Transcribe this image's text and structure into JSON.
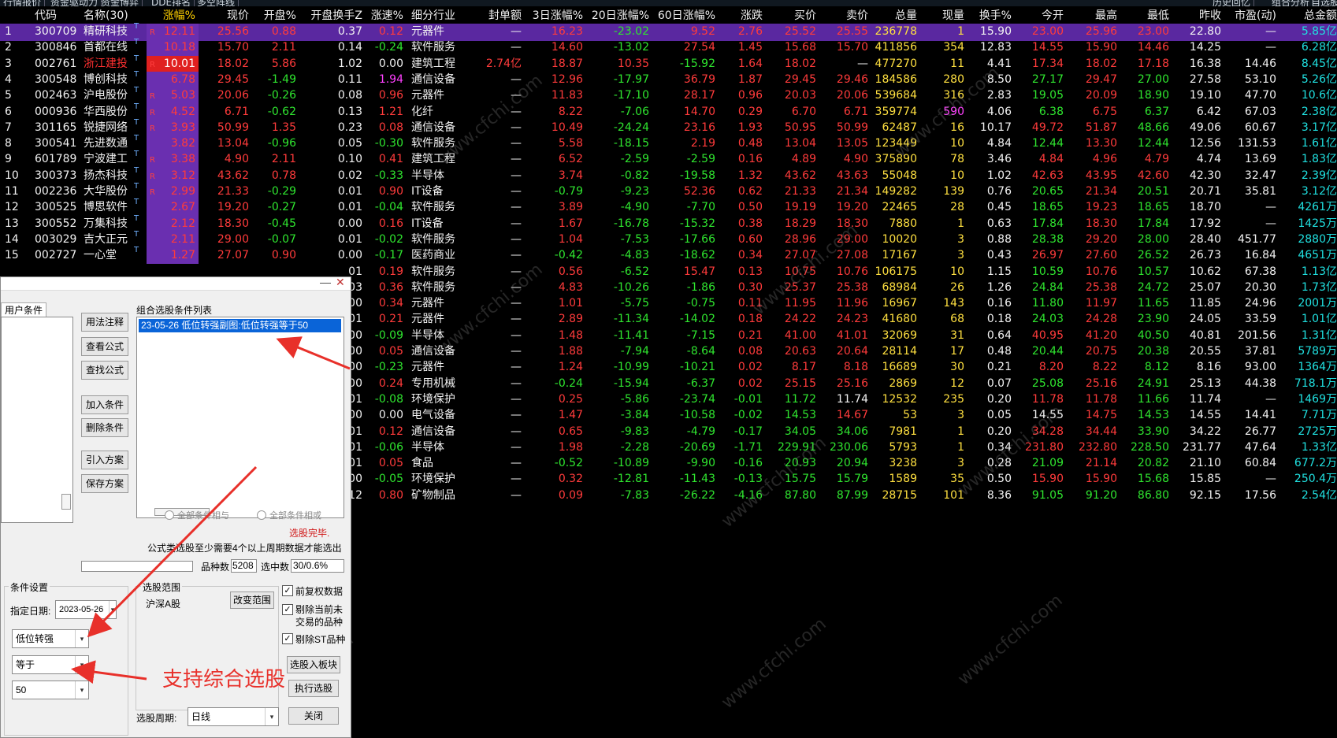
{
  "top_tabs": [
    "行情报价",
    "资金驱动力",
    "资金博弈",
    "DDE排名",
    "多空阵线",
    "历史回忆",
    "组合分析",
    "自选股"
  ],
  "header": {
    "idx": "",
    "code": "代码",
    "name": "名称(30)",
    "dot": "•",
    "zf": "涨幅%",
    "price": "现价",
    "kp": "开盘%",
    "kphs": "开盘换手Z",
    "zs": "涨速%",
    "hy": "细分行业",
    "fd": "封单额",
    "z3": "3日涨幅%",
    "z20": "20日涨幅%",
    "z60": "60日涨幅%",
    "zd": "涨跌",
    "buy": "买价",
    "sell": "卖价",
    "vol": "总量",
    "xl": "现量",
    "hs": "换手%",
    "jk": "今开",
    "zg": "最高",
    "zdi": "最低",
    "zs2": "昨收",
    "sy": "市盈(动)",
    "zje": "总金额"
  },
  "rows": [
    {
      "i": "1",
      "code": "300709",
      "name": "精研科技",
      "r": "R",
      "zf": "12.11",
      "p": "25.56",
      "kp": "0.88",
      "kphs": "0.37",
      "zs": "0.12",
      "hy": "元器件",
      "fd": "—",
      "z3": "16.23",
      "z20": "-23.02",
      "z60": "9.52",
      "zd": "2.76",
      "b": "25.52",
      "s": "25.55",
      "v": "236778",
      "x": "1",
      "h": "15.90",
      "jk": "23.00",
      "zg": "25.96",
      "zdi": "23.00",
      "zs2": "22.80",
      "sy": "—",
      "je": "5.85亿"
    },
    {
      "i": "2",
      "code": "300846",
      "name": "首都在线",
      "r": "",
      "zf": "10.18",
      "p": "15.70",
      "kp": "2.11",
      "kphs": "0.14",
      "zs": "-0.24",
      "hy": "软件服务",
      "fd": "—",
      "z3": "14.60",
      "z20": "-13.02",
      "z60": "27.54",
      "zd": "1.45",
      "b": "15.68",
      "s": "15.70",
      "v": "411856",
      "x": "354",
      "h": "12.83",
      "jk": "14.55",
      "zg": "15.90",
      "zdi": "14.46",
      "zs2": "14.25",
      "sy": "—",
      "je": "6.28亿"
    },
    {
      "i": "3",
      "code": "002761",
      "name": "浙江建投",
      "r": "R",
      "zf": "10.01",
      "p": "18.02",
      "kp": "5.86",
      "kphs": "1.02",
      "zs": "0.00",
      "hy": "建筑工程",
      "fd": "2.74亿",
      "z3": "18.87",
      "z20": "10.35",
      "z60": "-15.92",
      "zd": "1.64",
      "b": "18.02",
      "s": "—",
      "v": "477270",
      "x": "11",
      "h": "4.41",
      "jk": "17.34",
      "zg": "18.02",
      "zdi": "17.18",
      "zs2": "16.38",
      "sy": "14.46",
      "je": "8.45亿"
    },
    {
      "i": "4",
      "code": "300548",
      "name": "博创科技",
      "r": "",
      "zf": "6.78",
      "p": "29.45",
      "kp": "-1.49",
      "kphs": "0.11",
      "zs": "1.94",
      "hy": "通信设备",
      "fd": "—",
      "z3": "12.96",
      "z20": "-17.97",
      "z60": "36.79",
      "zd": "1.87",
      "b": "29.45",
      "s": "29.46",
      "v": "184586",
      "x": "280",
      "h": "8.50",
      "jk": "27.17",
      "zg": "29.47",
      "zdi": "27.00",
      "zs2": "27.58",
      "sy": "53.10",
      "je": "5.26亿"
    },
    {
      "i": "5",
      "code": "002463",
      "name": "沪电股份",
      "r": "R",
      "zf": "5.03",
      "p": "20.06",
      "kp": "-0.26",
      "kphs": "0.08",
      "zs": "0.96",
      "hy": "元器件",
      "fd": "—",
      "z3": "11.83",
      "z20": "-17.10",
      "z60": "28.17",
      "zd": "0.96",
      "b": "20.03",
      "s": "20.06",
      "v": "539684",
      "x": "316",
      "h": "2.83",
      "jk": "19.05",
      "zg": "20.09",
      "zdi": "18.90",
      "zs2": "19.10",
      "sy": "47.70",
      "je": "10.6亿"
    },
    {
      "i": "6",
      "code": "000936",
      "name": "华西股份",
      "r": "R",
      "zf": "4.52",
      "p": "6.71",
      "kp": "-0.62",
      "kphs": "0.13",
      "zs": "1.21",
      "hy": "化纤",
      "fd": "—",
      "z3": "8.22",
      "z20": "-7.06",
      "z60": "14.70",
      "zd": "0.29",
      "b": "6.70",
      "s": "6.71",
      "v": "359774",
      "x": "590",
      "h": "4.06",
      "jk": "6.38",
      "zg": "6.75",
      "zdi": "6.37",
      "zs2": "6.42",
      "sy": "67.03",
      "je": "2.38亿"
    },
    {
      "i": "7",
      "code": "301165",
      "name": "锐捷网络",
      "r": "R",
      "zf": "3.93",
      "p": "50.99",
      "kp": "1.35",
      "kphs": "0.23",
      "zs": "0.08",
      "hy": "通信设备",
      "fd": "—",
      "z3": "10.49",
      "z20": "-24.24",
      "z60": "23.16",
      "zd": "1.93",
      "b": "50.95",
      "s": "50.99",
      "v": "62487",
      "x": "16",
      "h": "10.17",
      "jk": "49.72",
      "zg": "51.87",
      "zdi": "48.66",
      "zs2": "49.06",
      "sy": "60.67",
      "je": "3.17亿"
    },
    {
      "i": "8",
      "code": "300541",
      "name": "先进数通",
      "r": "",
      "zf": "3.82",
      "p": "13.04",
      "kp": "-0.96",
      "kphs": "0.05",
      "zs": "-0.30",
      "hy": "软件服务",
      "fd": "—",
      "z3": "5.58",
      "z20": "-18.15",
      "z60": "2.19",
      "zd": "0.48",
      "b": "13.04",
      "s": "13.05",
      "v": "123449",
      "x": "10",
      "h": "4.84",
      "jk": "12.44",
      "zg": "13.30",
      "zdi": "12.44",
      "zs2": "12.56",
      "sy": "131.53",
      "je": "1.61亿"
    },
    {
      "i": "9",
      "code": "601789",
      "name": "宁波建工",
      "r": "R",
      "zf": "3.38",
      "p": "4.90",
      "kp": "2.11",
      "kphs": "0.10",
      "zs": "0.41",
      "hy": "建筑工程",
      "fd": "—",
      "z3": "6.52",
      "z20": "-2.59",
      "z60": "-2.59",
      "zd": "0.16",
      "b": "4.89",
      "s": "4.90",
      "v": "375890",
      "x": "78",
      "h": "3.46",
      "jk": "4.84",
      "zg": "4.96",
      "zdi": "4.79",
      "zs2": "4.74",
      "sy": "13.69",
      "je": "1.83亿"
    },
    {
      "i": "10",
      "code": "300373",
      "name": "扬杰科技",
      "r": "R",
      "zf": "3.12",
      "p": "43.62",
      "kp": "0.78",
      "kphs": "0.02",
      "zs": "-0.33",
      "hy": "半导体",
      "fd": "—",
      "z3": "3.74",
      "z20": "-0.82",
      "z60": "-19.58",
      "zd": "1.32",
      "b": "43.62",
      "s": "43.63",
      "v": "55048",
      "x": "10",
      "h": "1.02",
      "jk": "42.63",
      "zg": "43.95",
      "zdi": "42.60",
      "zs2": "42.30",
      "sy": "32.47",
      "je": "2.39亿"
    },
    {
      "i": "11",
      "code": "002236",
      "name": "大华股份",
      "r": "R",
      "zf": "2.99",
      "p": "21.33",
      "kp": "-0.29",
      "kphs": "0.01",
      "zs": "0.90",
      "hy": "IT设备",
      "fd": "—",
      "z3": "-0.79",
      "z20": "-9.23",
      "z60": "52.36",
      "zd": "0.62",
      "b": "21.33",
      "s": "21.34",
      "v": "149282",
      "x": "139",
      "h": "0.76",
      "jk": "20.65",
      "zg": "21.34",
      "zdi": "20.51",
      "zs2": "20.71",
      "sy": "35.81",
      "je": "3.12亿"
    },
    {
      "i": "12",
      "code": "300525",
      "name": "博思软件",
      "r": "",
      "zf": "2.67",
      "p": "19.20",
      "kp": "-0.27",
      "kphs": "0.01",
      "zs": "-0.04",
      "hy": "软件服务",
      "fd": "—",
      "z3": "3.89",
      "z20": "-4.90",
      "z60": "-7.70",
      "zd": "0.50",
      "b": "19.19",
      "s": "19.20",
      "v": "22465",
      "x": "28",
      "h": "0.45",
      "jk": "18.65",
      "zg": "19.23",
      "zdi": "18.65",
      "zs2": "18.70",
      "sy": "—",
      "je": "4261万"
    },
    {
      "i": "13",
      "code": "300552",
      "name": "万集科技",
      "r": "",
      "zf": "2.12",
      "p": "18.30",
      "kp": "-0.45",
      "kphs": "0.00",
      "zs": "0.16",
      "hy": "IT设备",
      "fd": "—",
      "z3": "1.67",
      "z20": "-16.78",
      "z60": "-15.32",
      "zd": "0.38",
      "b": "18.29",
      "s": "18.30",
      "v": "7880",
      "x": "1",
      "h": "0.63",
      "jk": "17.84",
      "zg": "18.30",
      "zdi": "17.84",
      "zs2": "17.92",
      "sy": "—",
      "je": "1425万"
    },
    {
      "i": "14",
      "code": "003029",
      "name": "吉大正元",
      "r": "",
      "zf": "2.11",
      "p": "29.00",
      "kp": "-0.07",
      "kphs": "0.01",
      "zs": "-0.02",
      "hy": "软件服务",
      "fd": "—",
      "z3": "1.04",
      "z20": "-7.53",
      "z60": "-17.66",
      "zd": "0.60",
      "b": "28.96",
      "s": "29.00",
      "v": "10020",
      "x": "3",
      "h": "0.88",
      "jk": "28.38",
      "zg": "29.20",
      "zdi": "28.00",
      "zs2": "28.40",
      "sy": "451.77",
      "je": "2880万"
    },
    {
      "i": "15",
      "code": "002727",
      "name": "一心堂",
      "r": "",
      "zf": "1.27",
      "p": "27.07",
      "kp": "0.90",
      "kphs": "0.00",
      "zs": "-0.17",
      "hy": "医药商业",
      "fd": "—",
      "z3": "-0.42",
      "z20": "-4.83",
      "z60": "-18.62",
      "zd": "0.34",
      "b": "27.07",
      "s": "27.08",
      "v": "17167",
      "x": "3",
      "h": "0.43",
      "jk": "26.97",
      "zg": "27.60",
      "zdi": "26.52",
      "zs2": "26.73",
      "sy": "16.84",
      "je": "4651万"
    },
    {
      "i": "",
      "code": "",
      "name": "",
      "r": "",
      "zf": "",
      "p": "",
      "kp": "",
      "kphs": "01",
      "zs": "0.19",
      "hy": "软件服务",
      "fd": "—",
      "z3": "0.56",
      "z20": "-6.52",
      "z60": "15.47",
      "zd": "0.13",
      "b": "10.75",
      "s": "10.76",
      "v": "106175",
      "x": "10",
      "h": "1.15",
      "jk": "10.59",
      "zg": "10.76",
      "zdi": "10.57",
      "zs2": "10.62",
      "sy": "67.38",
      "je": "1.13亿"
    },
    {
      "i": "",
      "code": "",
      "name": "",
      "r": "",
      "zf": "",
      "p": "",
      "kp": "",
      "kphs": "03",
      "zs": "0.36",
      "hy": "软件服务",
      "fd": "—",
      "z3": "4.83",
      "z20": "-10.26",
      "z60": "-1.86",
      "zd": "0.30",
      "b": "25.37",
      "s": "25.38",
      "v": "68984",
      "x": "26",
      "h": "1.26",
      "jk": "24.84",
      "zg": "25.38",
      "zdi": "24.72",
      "zs2": "25.07",
      "sy": "20.30",
      "je": "1.73亿"
    },
    {
      "i": "",
      "code": "",
      "name": "",
      "r": "",
      "zf": "",
      "p": "",
      "kp": "",
      "kphs": "00",
      "zs": "0.34",
      "hy": "元器件",
      "fd": "—",
      "z3": "1.01",
      "z20": "-5.75",
      "z60": "-0.75",
      "zd": "0.11",
      "b": "11.95",
      "s": "11.96",
      "v": "16967",
      "x": "143",
      "h": "0.16",
      "jk": "11.80",
      "zg": "11.97",
      "zdi": "11.65",
      "zs2": "11.85",
      "sy": "24.96",
      "je": "2001万"
    },
    {
      "i": "",
      "code": "",
      "name": "",
      "r": "",
      "zf": "",
      "p": "",
      "kp": "",
      "kphs": "01",
      "zs": "0.21",
      "hy": "元器件",
      "fd": "—",
      "z3": "2.89",
      "z20": "-11.34",
      "z60": "-14.02",
      "zd": "0.18",
      "b": "24.22",
      "s": "24.23",
      "v": "41680",
      "x": "68",
      "h": "0.18",
      "jk": "24.03",
      "zg": "24.28",
      "zdi": "23.90",
      "zs2": "24.05",
      "sy": "33.59",
      "je": "1.01亿"
    },
    {
      "i": "",
      "code": "",
      "name": "",
      "r": "",
      "zf": "",
      "p": "",
      "kp": "",
      "kphs": "00",
      "zs": "-0.09",
      "hy": "半导体",
      "fd": "—",
      "z3": "1.48",
      "z20": "-11.41",
      "z60": "-7.15",
      "zd": "0.21",
      "b": "41.00",
      "s": "41.01",
      "v": "32069",
      "x": "31",
      "h": "0.64",
      "jk": "40.95",
      "zg": "41.20",
      "zdi": "40.50",
      "zs2": "40.81",
      "sy": "201.56",
      "je": "1.31亿"
    },
    {
      "i": "",
      "code": "",
      "name": "",
      "r": "",
      "zf": "",
      "p": "",
      "kp": "",
      "kphs": "00",
      "zs": "0.05",
      "hy": "通信设备",
      "fd": "—",
      "z3": "1.88",
      "z20": "-7.94",
      "z60": "-8.64",
      "zd": "0.08",
      "b": "20.63",
      "s": "20.64",
      "v": "28114",
      "x": "17",
      "h": "0.48",
      "jk": "20.44",
      "zg": "20.75",
      "zdi": "20.38",
      "zs2": "20.55",
      "sy": "37.81",
      "je": "5789万"
    },
    {
      "i": "",
      "code": "",
      "name": "",
      "r": "",
      "zf": "",
      "p": "",
      "kp": "",
      "kphs": "00",
      "zs": "-0.23",
      "hy": "元器件",
      "fd": "—",
      "z3": "1.24",
      "z20": "-10.99",
      "z60": "-10.21",
      "zd": "0.02",
      "b": "8.17",
      "s": "8.18",
      "v": "16689",
      "x": "30",
      "h": "0.21",
      "jk": "8.20",
      "zg": "8.22",
      "zdi": "8.12",
      "zs2": "8.16",
      "sy": "93.00",
      "je": "1364万"
    },
    {
      "i": "",
      "code": "",
      "name": "",
      "r": "",
      "zf": "",
      "p": "",
      "kp": "",
      "kphs": "00",
      "zs": "0.24",
      "hy": "专用机械",
      "fd": "—",
      "z3": "-0.24",
      "z20": "-15.94",
      "z60": "-6.37",
      "zd": "0.02",
      "b": "25.15",
      "s": "25.16",
      "v": "2869",
      "x": "12",
      "h": "0.07",
      "jk": "25.08",
      "zg": "25.16",
      "zdi": "24.91",
      "zs2": "25.13",
      "sy": "44.38",
      "je": "718.1万"
    },
    {
      "i": "",
      "code": "",
      "name": "",
      "r": "",
      "zf": "",
      "p": "",
      "kp": "",
      "kphs": "01",
      "zs": "-0.08",
      "hy": "环境保护",
      "fd": "—",
      "z3": "0.25",
      "z20": "-5.86",
      "z60": "-23.74",
      "zd": "-0.01",
      "b": "11.72",
      "s": "11.74",
      "v": "12532",
      "x": "235",
      "h": "0.20",
      "jk": "11.78",
      "zg": "11.78",
      "zdi": "11.66",
      "zs2": "11.74",
      "sy": "—",
      "je": "1469万"
    },
    {
      "i": "",
      "code": "",
      "name": "",
      "r": "",
      "zf": "",
      "p": "",
      "kp": "",
      "kphs": "00",
      "zs": "0.00",
      "hy": "电气设备",
      "fd": "—",
      "z3": "1.47",
      "z20": "-3.84",
      "z60": "-10.58",
      "zd": "-0.02",
      "b": "14.53",
      "s": "14.67",
      "v": "53",
      "x": "3",
      "h": "0.05",
      "jk": "14.55",
      "zg": "14.75",
      "zdi": "14.53",
      "zs2": "14.55",
      "sy": "14.41",
      "je": "7.71万"
    },
    {
      "i": "",
      "code": "",
      "name": "",
      "r": "",
      "zf": "",
      "p": "",
      "kp": "",
      "kphs": "01",
      "zs": "0.12",
      "hy": "通信设备",
      "fd": "—",
      "z3": "0.65",
      "z20": "-9.83",
      "z60": "-4.79",
      "zd": "-0.17",
      "b": "34.05",
      "s": "34.06",
      "v": "7981",
      "x": "1",
      "h": "0.20",
      "jk": "34.28",
      "zg": "34.44",
      "zdi": "33.90",
      "zs2": "34.22",
      "sy": "26.77",
      "je": "2725万"
    },
    {
      "i": "",
      "code": "",
      "name": "",
      "r": "",
      "zf": "",
      "p": "",
      "kp": "",
      "kphs": "01",
      "zs": "-0.06",
      "hy": "半导体",
      "fd": "—",
      "z3": "1.98",
      "z20": "-2.28",
      "z60": "-20.69",
      "zd": "-1.71",
      "b": "229.91",
      "s": "230.06",
      "v": "5793",
      "x": "1",
      "h": "0.34",
      "jk": "231.80",
      "zg": "232.80",
      "zdi": "228.50",
      "zs2": "231.77",
      "sy": "47.64",
      "je": "1.33亿"
    },
    {
      "i": "",
      "code": "",
      "name": "",
      "r": "",
      "zf": "",
      "p": "",
      "kp": "",
      "kphs": "01",
      "zs": "0.05",
      "hy": "食品",
      "fd": "—",
      "z3": "-0.52",
      "z20": "-10.89",
      "z60": "-9.90",
      "zd": "-0.16",
      "b": "20.93",
      "s": "20.94",
      "v": "3238",
      "x": "3",
      "h": "0.28",
      "jk": "21.09",
      "zg": "21.14",
      "zdi": "20.82",
      "zs2": "21.10",
      "sy": "60.84",
      "je": "677.2万"
    },
    {
      "i": "",
      "code": "",
      "name": "",
      "r": "",
      "zf": "",
      "p": "",
      "kp": "",
      "kphs": "00",
      "zs": "-0.05",
      "hy": "环境保护",
      "fd": "—",
      "z3": "0.32",
      "z20": "-12.81",
      "z60": "-11.43",
      "zd": "-0.13",
      "b": "15.75",
      "s": "15.79",
      "v": "1589",
      "x": "35",
      "h": "0.50",
      "jk": "15.90",
      "zg": "15.90",
      "zdi": "15.68",
      "zs2": "15.85",
      "sy": "—",
      "je": "250.4万"
    },
    {
      "i": "",
      "code": "",
      "name": "",
      "r": "",
      "zf": "",
      "p": "",
      "kp": "",
      "kphs": "12",
      "zs": "0.80",
      "hy": "矿物制品",
      "fd": "—",
      "z3": "0.09",
      "z20": "-7.83",
      "z60": "-26.22",
      "zd": "-4.16",
      "b": "87.80",
      "s": "87.99",
      "v": "28715",
      "x": "101",
      "h": "8.36",
      "jk": "91.05",
      "zg": "91.20",
      "zdi": "86.80",
      "zs2": "92.15",
      "sy": "17.56",
      "je": "2.54亿"
    }
  ],
  "dialog": {
    "tab_user": "用户条件",
    "list_title": "组合选股条件列表",
    "list_item": "23-05-26 低位转强副图:低位转强等于50",
    "buttons": {
      "usage": "用法注释",
      "view_formula": "查看公式",
      "find_formula": "查找公式",
      "add_cond": "加入条件",
      "del_cond": "删除条件",
      "import": "引入方案",
      "save": "保存方案",
      "change_range": "改变范围",
      "to_block": "选股入板块",
      "execute": "执行选股",
      "close": "关闭"
    },
    "radio_and": "全部条件相与",
    "radio_or": "全部条件相或",
    "status_done": "选股完毕.",
    "note": "公式类选股至少需要4个以上周期数据才能选出",
    "count_label": "品种数",
    "count_value": "5208",
    "selected_label": "选中数",
    "selected_value": "30/0.6%",
    "cond_group": "条件设置",
    "date_label": "指定日期:",
    "date_value": "2023-05-26",
    "indicator_value": "低位转强",
    "operator_value": "等于",
    "number_value": "50",
    "range_group": "选股范围",
    "range_value": "沪深A股",
    "chk_fq": "前复权数据",
    "chk_remove_untraded": "剔除当前未交易的品种",
    "chk_remove_st": "剔除ST品种",
    "period_label": "选股周期:",
    "period_value": "日线"
  },
  "annotation": "支持综合选股",
  "watermark": "www.cfchi.com"
}
